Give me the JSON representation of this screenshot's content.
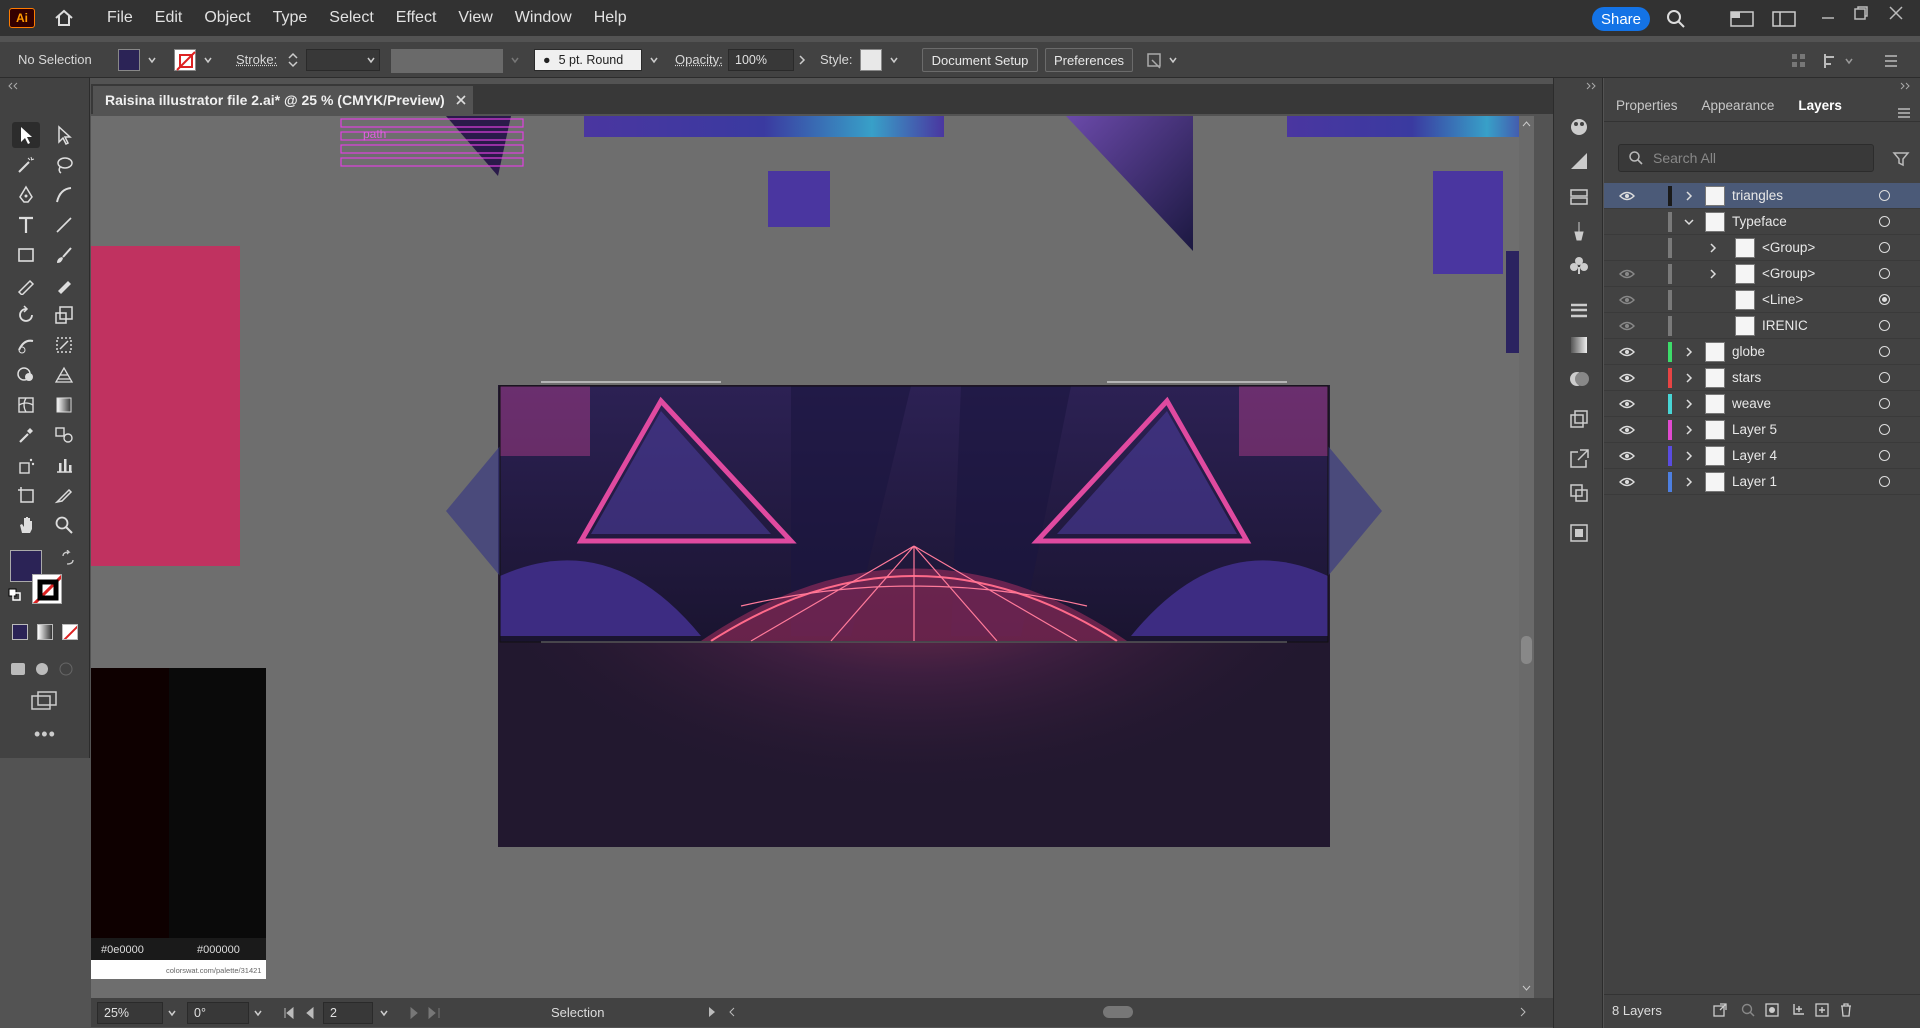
{
  "app": {
    "logo": "Ai",
    "share_label": "Share"
  },
  "menu": [
    "File",
    "Edit",
    "Object",
    "Type",
    "Select",
    "Effect",
    "View",
    "Window",
    "Help"
  ],
  "control_bar": {
    "selection_status": "No Selection",
    "stroke_label": "Stroke:",
    "brush_value": "5 pt. Round",
    "opacity_label": "Opacity:",
    "opacity_value": "100%",
    "style_label": "Style:",
    "document_setup": "Document Setup",
    "preferences": "Preferences"
  },
  "document": {
    "tab_title": "Raisina illustrator file 2.ai* @ 25 % (CMYK/Preview)"
  },
  "artboard": {
    "path_label": "path",
    "hex_left": "#0e0000",
    "hex_right": "#000000",
    "palette_url": "colorswat.com/palette/31421",
    "colors": {
      "magenta": "#c03260",
      "purple": "#4a36a0",
      "deep": "#22182f",
      "dark_swatch": "#0e0000"
    }
  },
  "panel": {
    "tabs": [
      "Properties",
      "Appearance",
      "Layers"
    ],
    "active_tab": "Layers",
    "search_placeholder": "Search All",
    "layers": [
      {
        "name": "triangles",
        "color": "#2b2b2b",
        "selected": true
      },
      {
        "name": "Typeface",
        "color": "#7a7a7a"
      },
      {
        "name": "<Group>",
        "color": "#7a7a7a"
      },
      {
        "name": "<Group>",
        "color": "#7a7a7a"
      },
      {
        "name": "<Line>",
        "color": "#7a7a7a"
      },
      {
        "name": "IRENIC",
        "color": "#7a7a7a"
      },
      {
        "name": "globe",
        "color": "#3ddc6a"
      },
      {
        "name": "stars",
        "color": "#e74444"
      },
      {
        "name": "weave",
        "color": "#48d5d5"
      },
      {
        "name": "Layer 5",
        "color": "#e04ad0"
      },
      {
        "name": "Layer 4",
        "color": "#5a4ce0"
      },
      {
        "name": "Layer 1",
        "color": "#4d7fe0"
      }
    ],
    "layer_count": "8 Layers"
  },
  "status": {
    "zoom": "25%",
    "rotation": "0°",
    "artboard_number": "2",
    "tool": "Selection"
  }
}
